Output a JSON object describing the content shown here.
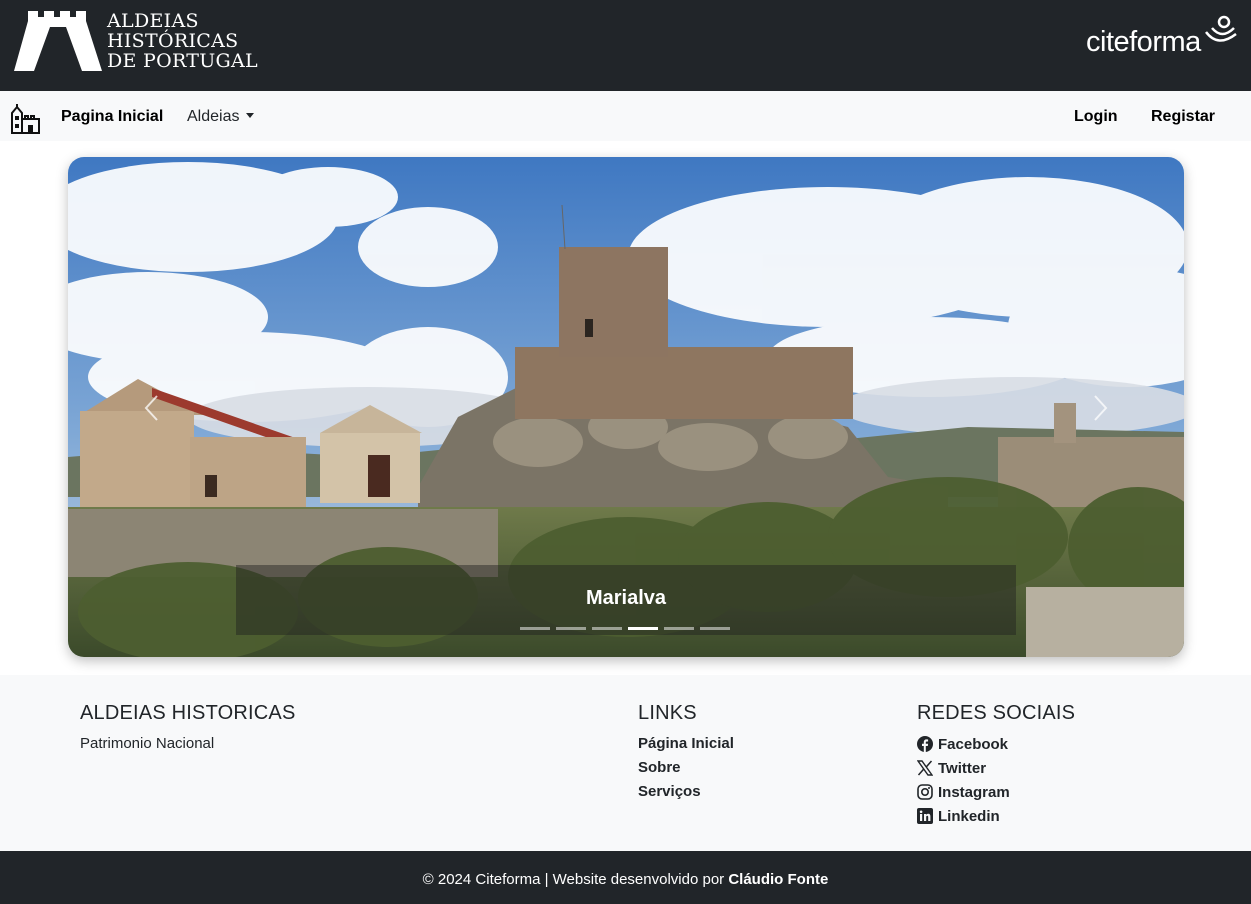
{
  "brand": {
    "logo_lines": [
      "ALDEIAS",
      "HISTÓRICAS",
      "DE PORTUGAL"
    ],
    "partner_name": "citeforma"
  },
  "nav": {
    "home_label": "Pagina Inicial",
    "villages_label": "Aldeias",
    "login_label": "Login",
    "register_label": "Registar"
  },
  "carousel": {
    "caption": "Marialva",
    "slide_count": 6,
    "active_index": 3
  },
  "footer": {
    "about_heading": "ALDEIAS HISTORICAS",
    "about_text": "Patrimonio Nacional",
    "links_heading": "LINKS",
    "links": [
      "Página Inicial",
      "Sobre",
      "Serviços"
    ],
    "social_heading": "REDES SOCIAIS",
    "social": [
      {
        "label": "Facebook",
        "icon": "facebook-icon"
      },
      {
        "label": "Twitter",
        "icon": "x-twitter-icon"
      },
      {
        "label": "Instagram",
        "icon": "instagram-icon"
      },
      {
        "label": "Linkedin",
        "icon": "linkedin-icon"
      }
    ]
  },
  "bottom": {
    "copyright_prefix": "© 2024 Citeforma | Website desenvolvido por ",
    "author": "Cláudio Fonte"
  },
  "colors": {
    "dark": "#212529",
    "light": "#f8f9fa"
  }
}
